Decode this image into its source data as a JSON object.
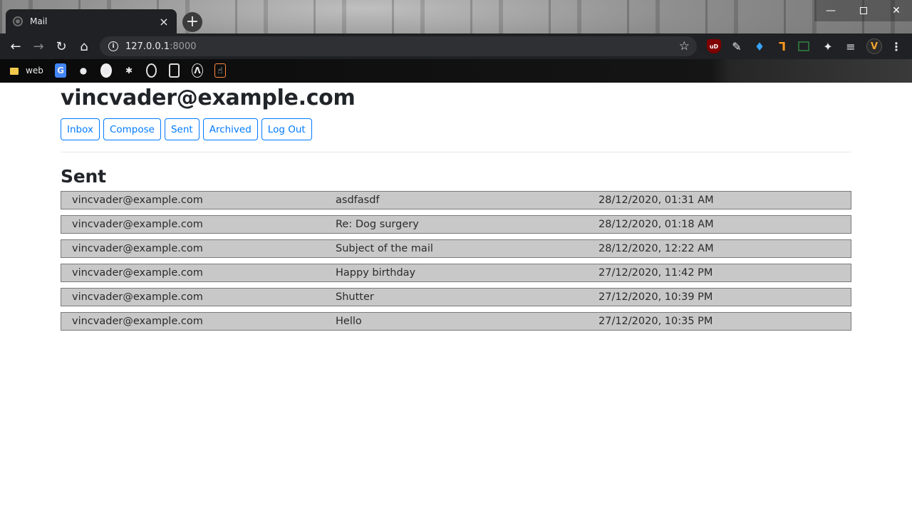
{
  "browser": {
    "tab_title": "Mail",
    "url_host": "127.0.0.1",
    "url_port": ":8000",
    "bookmarks": {
      "folder_label": "web"
    },
    "extensions": {
      "ublock_label": "uD",
      "profile_initial": "V"
    }
  },
  "page": {
    "user_email": "vincvader@example.com",
    "nav": {
      "inbox": "Inbox",
      "compose": "Compose",
      "sent": "Sent",
      "archived": "Archived",
      "logout": "Log Out"
    },
    "section_title": "Sent",
    "emails": [
      {
        "sender": "vincvader@example.com",
        "subject": "asdfasdf",
        "timestamp": "28/12/2020, 01:31 AM"
      },
      {
        "sender": "vincvader@example.com",
        "subject": "Re: Dog surgery",
        "timestamp": "28/12/2020, 01:18 AM"
      },
      {
        "sender": "vincvader@example.com",
        "subject": "Subject of the mail",
        "timestamp": "28/12/2020, 12:22 AM"
      },
      {
        "sender": "vincvader@example.com",
        "subject": "Happy birthday",
        "timestamp": "27/12/2020, 11:42 PM"
      },
      {
        "sender": "vincvader@example.com",
        "subject": "Shutter",
        "timestamp": "27/12/2020, 10:39 PM"
      },
      {
        "sender": "vincvader@example.com",
        "subject": "Hello",
        "timestamp": "27/12/2020, 10:35 PM"
      }
    ]
  },
  "colors": {
    "row_background": "#c8c8c8",
    "button_accent": "#007bff",
    "toolbar_background": "#202124"
  }
}
